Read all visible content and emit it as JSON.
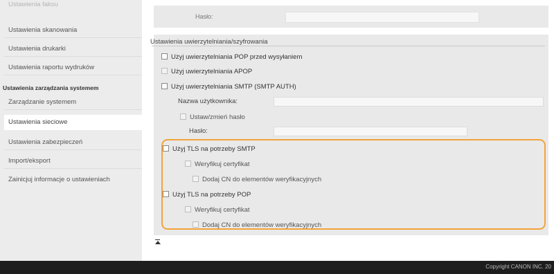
{
  "sidebar": {
    "top_faded": "Ustawienia faksu",
    "items": [
      "Ustawienia skanowania",
      "Ustawienia drukarki",
      "Ustawienia raportu wydruków"
    ],
    "group_header": "Ustawienia zarządzania systemem",
    "group_items": [
      "Zarządzanie systemem",
      "Ustawienia sieciowe",
      "Ustawienia zabezpieczeń",
      "Import/eksport",
      "Zainicjuj informacje o ustawieniach"
    ],
    "active_item": "Ustawienia sieciowe"
  },
  "top_panel": {
    "password_label": "Hasło:"
  },
  "auth_section": {
    "title": "Ustawienia uwierzytelniania/szyfrowania",
    "pop_before_send": "Użyj uwierzytelniania POP przed wysyłaniem",
    "apop": "Użyj uwierzytelniania APOP",
    "smtp_auth": "Użyj uwierzytelniania SMTP (SMTP AUTH)",
    "username_label": "Nazwa użytkownika:",
    "set_change_password": "Ustaw/zmień hasło",
    "password_label": "Hasło:",
    "tls_smtp": "Użyj TLS na potrzeby SMTP",
    "verify_cert_smtp": "Weryfikuj certyfikat",
    "add_cn_smtp": "Dodaj CN do elementów weryfikacyjnych",
    "tls_pop": "Użyj TLS na potrzeby POP",
    "verify_cert_pop": "Weryfikuj certyfikat",
    "add_cn_pop": "Dodaj CN do elementów weryfikacyjnych"
  },
  "to_top_icon": "back-to-top-icon",
  "highlight_color": "#f2a33a",
  "footer": {
    "copyright": "Copyright CANON INC. 20"
  }
}
